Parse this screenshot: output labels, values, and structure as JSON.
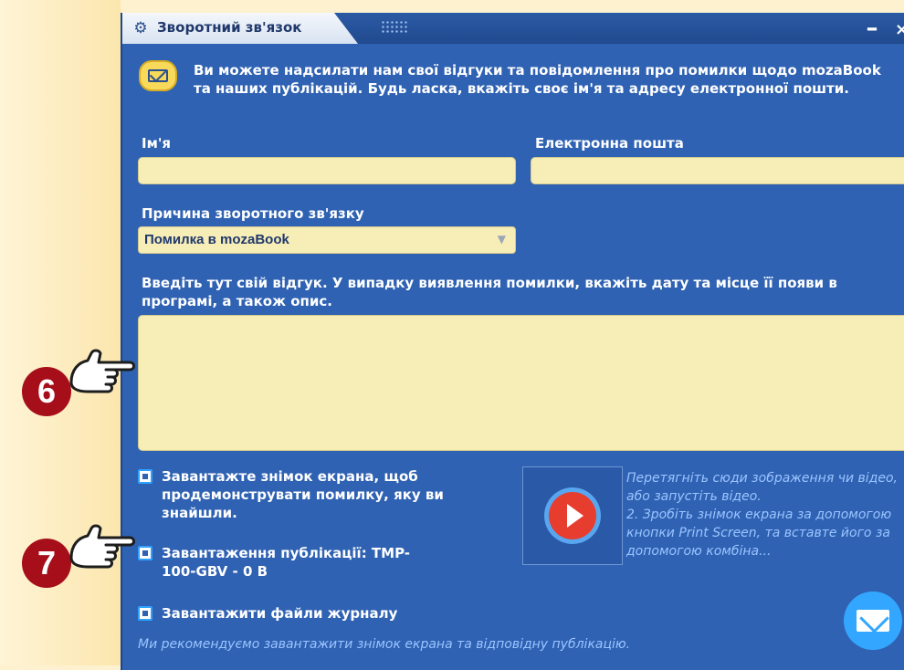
{
  "window": {
    "title": "Зворотний зв'язок",
    "controls": {
      "minimize": "–",
      "close": "×"
    }
  },
  "intro_text": "Ви можете надсилати нам свої відгуки та повідомлення про помилки щодо mozaBook та наших публікацій. Будь ласка, вкажіть своє ім'я та адресу електронної пошти.",
  "form": {
    "name_label": "Ім'я",
    "name_value": "",
    "email_label": "Електронна пошта",
    "email_value": "",
    "reason_label": "Причина зворотного зв'язку",
    "reason_value": "Помилка в mozaBook",
    "feedback_label": "Введіть тут свій відгук. У випадку виявлення помилки, вкажіть дату та місце її появи в програмі, а також опис.",
    "feedback_value": ""
  },
  "checkboxes": [
    {
      "label": "Завантажте знімок екрана, щоб продемонструвати помилку, яку ви знайшли.",
      "checked": false
    },
    {
      "label": "Завантаження публікації: TMP-100-GBV - 0 B",
      "checked": false
    },
    {
      "label": "Завантажити файли журналу",
      "checked": false
    }
  ],
  "video_help": "Перетягніть сюди зображення чи відео, або запустіть відео.\n2. Зробіть знімок екрана за допомогою кнопки Print Screen, та вставте його за допомогою комбіна...",
  "recommendation": "Ми рекомендуємо завантажити знімок екрана та відповідну публікацію.",
  "callouts": {
    "six": "6",
    "seven": "7"
  },
  "colors": {
    "window": "#2f62b3",
    "field": "#f6edb7",
    "accent": "#33a7ff",
    "callout": "#a60f1a"
  },
  "icons": {
    "settings": "gear-icon",
    "message": "mail-icon",
    "play": "play-icon",
    "send": "send-mail-icon",
    "pointer": "pointing-hand-icon"
  }
}
